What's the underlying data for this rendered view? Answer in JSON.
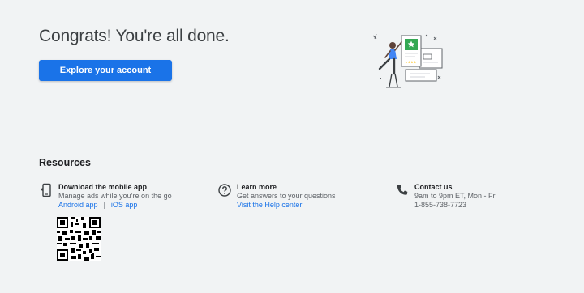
{
  "main": {
    "headline": "Congrats! You're all done.",
    "cta_label": "Explore your account"
  },
  "resources": {
    "title": "Resources",
    "mobile": {
      "heading": "Download the mobile app",
      "description": "Manage ads while you’re on the go",
      "android_label": "Android app",
      "separator": "|",
      "ios_label": "iOS app",
      "icon": "phone-icon"
    },
    "learn": {
      "heading": "Learn more",
      "description": "Get answers to your questions",
      "link_label": "Visit the Help center",
      "icon": "help-circle-icon"
    },
    "contact": {
      "heading": "Contact us",
      "hours": "9am to 9pm ET, Mon - Fri",
      "phone": "1-855-738-7723",
      "icon": "phone-handset-icon"
    }
  },
  "colors": {
    "background": "#f1f3f4",
    "primary": "#1a73e8",
    "accent_green": "#34a853"
  }
}
